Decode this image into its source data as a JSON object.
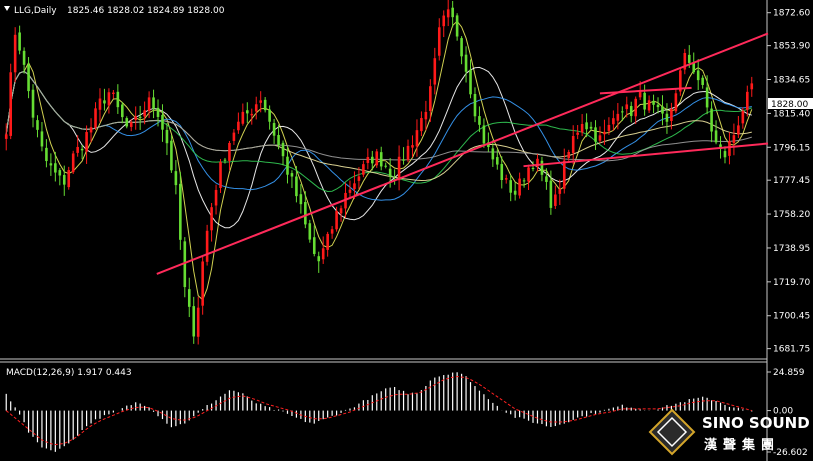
{
  "header": {
    "symbol": "LLG,Daily",
    "ohlc": "1825.46 1828.02 1824.89 1828.00"
  },
  "current_price_label": "1828.00",
  "macd_panel": {
    "label": "MACD(12,26,9) 1.917 0.443",
    "ticks": [
      "24.859",
      "0.00",
      "-26.602"
    ]
  },
  "logo": {
    "name_en": "SINO SOUND",
    "name_cn": "漢聲集團"
  },
  "colors": {
    "background": "#000000",
    "bull": "#ff1a1a",
    "bear": "#66dd33",
    "trendline": "#ff2a5a",
    "macd_hist": "#ffffff",
    "macd_signal": "#ff2020"
  },
  "chart_data": {
    "type": "candlestick",
    "title": "LLG,Daily",
    "ylim": [
      1677,
      1873
    ],
    "yticks": [
      "1872.60",
      "1853.90",
      "1834.65",
      "1815.40",
      "1796.15",
      "1777.45",
      "1758.20",
      "1738.95",
      "1719.70",
      "1700.45",
      "1681.75"
    ],
    "price_path": [
      1808,
      1865,
      1838,
      1810,
      1790,
      1782,
      1775,
      1790,
      1798,
      1808,
      1822,
      1828,
      1815,
      1805,
      1812,
      1822,
      1818,
      1800,
      1770,
      1710,
      1690,
      1740,
      1770,
      1790,
      1805,
      1812,
      1818,
      1825,
      1810,
      1795,
      1780,
      1765,
      1745,
      1730,
      1742,
      1758,
      1770,
      1778,
      1785,
      1792,
      1788,
      1780,
      1790,
      1800,
      1812,
      1828,
      1865,
      1872,
      1858,
      1835,
      1810,
      1795,
      1785,
      1775,
      1770,
      1782,
      1790,
      1776,
      1762,
      1782,
      1800,
      1812,
      1806,
      1800,
      1808,
      1822,
      1815,
      1825,
      1820,
      1815,
      1808,
      1830,
      1848,
      1840,
      1825,
      1800,
      1790,
      1802,
      1818,
      1828
    ],
    "trendlines": [
      {
        "from": [
          0.0,
          1690.0
        ],
        "to": [
          1.0,
          1860.8
        ]
      },
      {
        "from": [
          0.0,
          1758.0
        ],
        "to": [
          1.0,
          1798.3
        ]
      },
      {
        "from": [
          0.0,
          1806.5
        ],
        "to": [
          1.0,
          1832.5
        ]
      }
    ],
    "macd": {
      "ylim": [
        -26.602,
        24.859
      ],
      "histogram_path": [
        10,
        0,
        -15,
        -22,
        -25,
        -22,
        -15,
        -8,
        -4,
        -2,
        2,
        5,
        3,
        -4,
        -10,
        -8,
        -3,
        3,
        8,
        13,
        10,
        5,
        2,
        0,
        -3,
        -6,
        -8,
        -5,
        -2,
        1,
        5,
        9,
        13,
        14,
        10,
        12,
        20,
        22,
        24,
        20,
        12,
        6,
        0,
        -4,
        -6,
        -8,
        -10,
        -8,
        -5,
        -3,
        -1,
        1,
        3,
        2,
        0,
        1,
        3,
        5,
        7,
        8,
        6,
        3,
        1,
        -1
      ],
      "signal_path": [
        0,
        -6,
        -12,
        -18,
        -21,
        -20,
        -16,
        -10,
        -6,
        -3,
        0,
        2,
        2,
        -1,
        -5,
        -6,
        -4,
        0,
        4,
        8,
        9,
        7,
        4,
        2,
        0,
        -3,
        -5,
        -5,
        -3,
        -1,
        2,
        5,
        8,
        10,
        10,
        11,
        15,
        19,
        21,
        20,
        16,
        11,
        6,
        1,
        -2,
        -5,
        -7,
        -7,
        -6,
        -4,
        -2,
        -1,
        1,
        1,
        1,
        1,
        2,
        3,
        5,
        6,
        6,
        4,
        2,
        0
      ]
    }
  }
}
